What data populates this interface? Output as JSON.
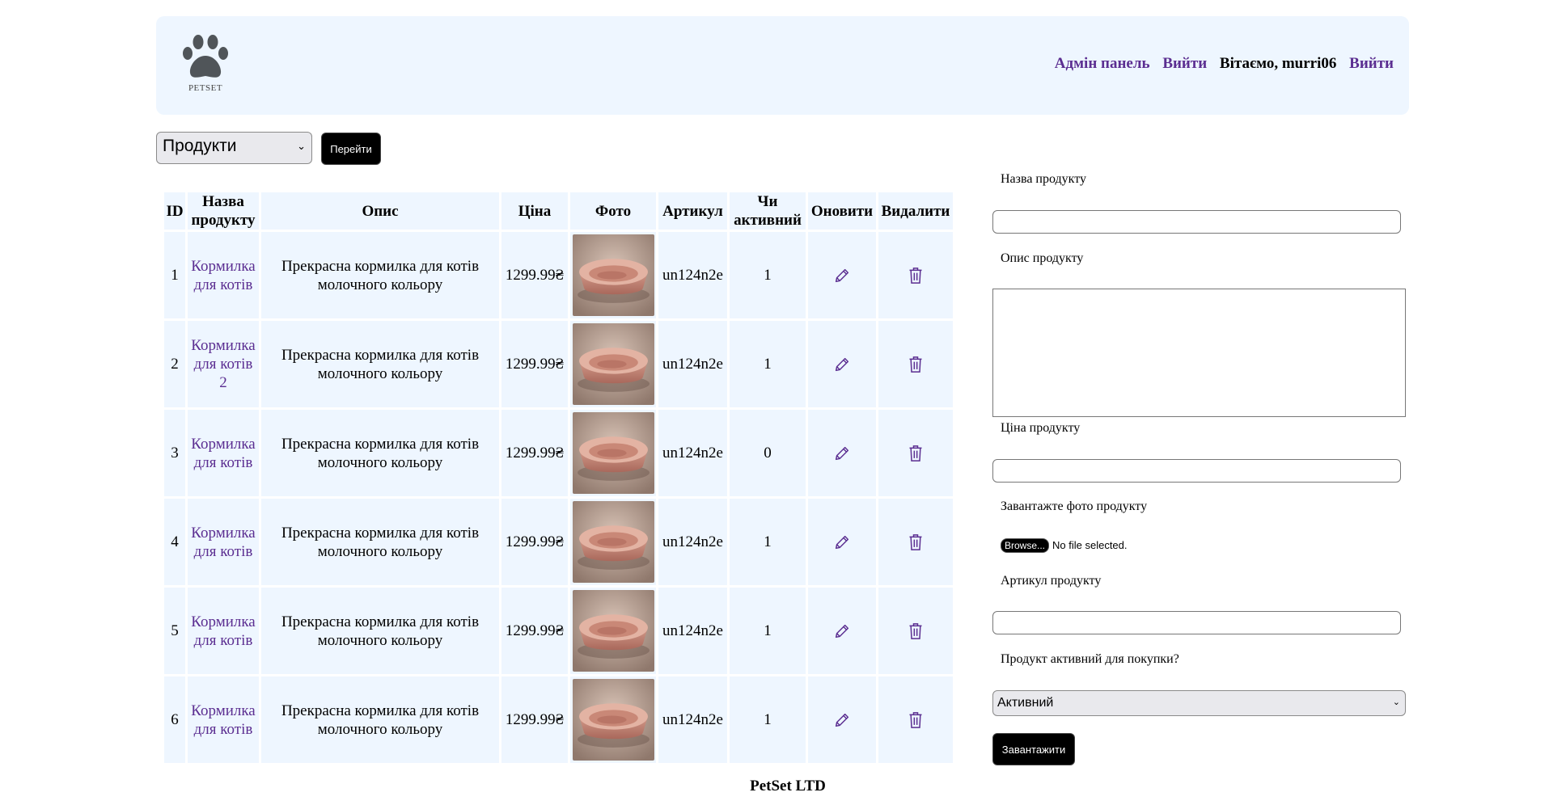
{
  "header": {
    "logo_text": "PETSET",
    "nav": {
      "admin_link": "Адмін панель",
      "logout_link_1": "Вийти",
      "greeting": "Вітаємо, murri06",
      "logout_link_2": "Вийти"
    }
  },
  "section_select": {
    "value": "Продукти",
    "go_button": "Перейти"
  },
  "table": {
    "headers": {
      "id": "ID",
      "name": "Назва продукту",
      "description": "Опис",
      "price": "Ціна",
      "photo": "Фото",
      "sku": "Артикул",
      "active": "Чи активний",
      "update": "Оновити",
      "delete": "Видалити"
    },
    "rows": [
      {
        "id": "1",
        "name": "Кормилка для котів",
        "description": "Прекрасна кормилка для котів молочного кольору",
        "price": "1299.99₴",
        "sku": "un124n2e",
        "active": "1"
      },
      {
        "id": "2",
        "name": "Кормилка для котів 2",
        "description": "Прекрасна кормилка для котів молочного кольору",
        "price": "1299.99₴",
        "sku": "un124n2e",
        "active": "1"
      },
      {
        "id": "3",
        "name": "Кормилка для котів",
        "description": "Прекрасна кормилка для котів молочного кольору",
        "price": "1299.99₴",
        "sku": "un124n2e",
        "active": "0"
      },
      {
        "id": "4",
        "name": "Кормилка для котів",
        "description": "Прекрасна кормилка для котів молочного кольору",
        "price": "1299.99₴",
        "sku": "un124n2e",
        "active": "1"
      },
      {
        "id": "5",
        "name": "Кормилка для котів",
        "description": "Прекрасна кормилка для котів молочного кольору",
        "price": "1299.99₴",
        "sku": "un124n2e",
        "active": "1"
      },
      {
        "id": "6",
        "name": "Кормилка для котів",
        "description": "Прекрасна кормилка для котів молочного кольору",
        "price": "1299.99₴",
        "sku": "un124n2e",
        "active": "1"
      }
    ]
  },
  "form": {
    "name_label": "Назва продукту",
    "name_value": "",
    "description_label": "Опис продукту",
    "description_value": "",
    "price_label": "Ціна продукту",
    "price_value": "",
    "photo_label": "Завантажте фото продукту",
    "browse_button": "Browse...",
    "file_status": "No file selected.",
    "sku_label": "Артикул продукту",
    "sku_value": "",
    "active_label": "Продукт активний для покупки?",
    "active_value": "Активний",
    "submit_button": "Завантажити"
  },
  "footer": {
    "text": "PetSet LTD"
  },
  "colors": {
    "link": "#5b2e91",
    "header_bg": "#eef6ff",
    "cell_bg": "#eef6ff",
    "icon": "#5b2e91",
    "button_bg": "#000000"
  },
  "icons": {
    "logo": "paw-icon",
    "update": "pencil-icon",
    "delete": "trash-icon",
    "select_arrow": "chevron-down-icon"
  }
}
